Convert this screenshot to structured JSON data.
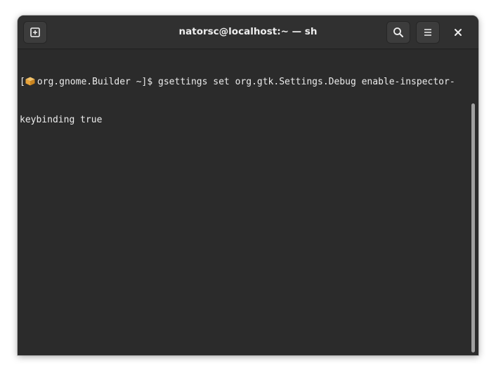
{
  "window": {
    "title": "natorsc@localhost:~ — sh"
  },
  "headerbar": {
    "new_tab_icon": "new-tab-icon",
    "search_icon": "search-icon",
    "menu_icon": "hamburger-menu-icon",
    "close_icon": "close-icon"
  },
  "terminal": {
    "prompt_open": "[",
    "prompt_context": "org.gnome.Builder ~]$ ",
    "command_line1": "gsettings set org.gtk.Settings.Debug enable-inspector-",
    "command_line2": "keybinding true"
  },
  "colors": {
    "background": "#2b2b2b",
    "headerbar": "#303030",
    "text": "#ececec",
    "package_icon": "#e8a33a"
  }
}
